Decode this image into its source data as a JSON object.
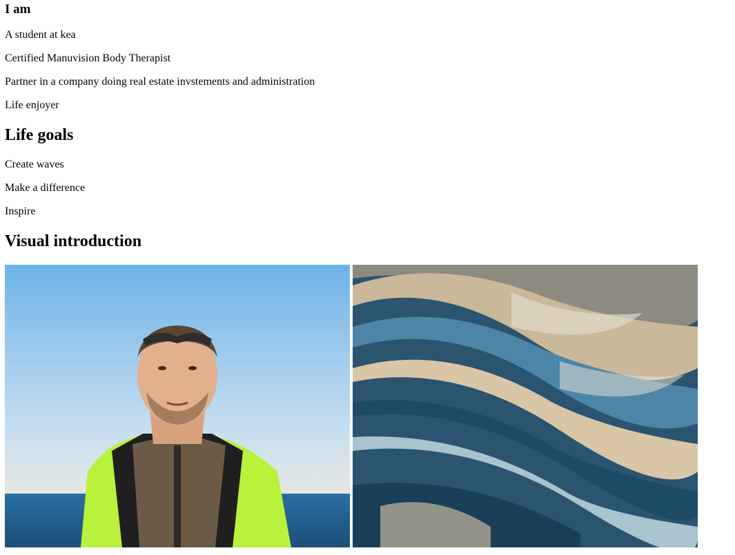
{
  "about": {
    "heading": "I am",
    "items": [
      "A student at kea",
      "Certified Manuvision Body Therapist",
      "Partner in a company doing real estate invstements and administration",
      "Life enjoyer"
    ]
  },
  "goals": {
    "heading": "Life goals",
    "items": [
      "Create waves",
      "Make a difference",
      "Inspire"
    ]
  },
  "visual": {
    "heading": "Visual introduction",
    "images": [
      {
        "subject": "portrait-photo"
      },
      {
        "subject": "abstract-waves-photo"
      }
    ]
  }
}
